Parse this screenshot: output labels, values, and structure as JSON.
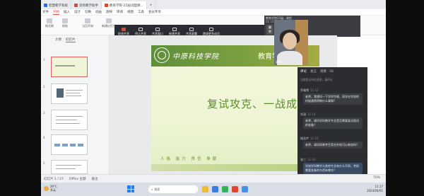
{
  "tabs": [
    {
      "label": "智慧教学系统"
    },
    {
      "label": "双师教学助手"
    },
    {
      "label": "教育学院-25届试面课..."
    },
    {
      "label": "+"
    }
  ],
  "menu": [
    "文件",
    "开始",
    "插入",
    "设计",
    "切换",
    "动画",
    "放映",
    "审阅",
    "视图",
    "工具",
    "会员专享"
  ],
  "ribbon": [
    "格式刷",
    "粘贴",
    "当页开始",
    "新建幻灯片",
    "版式",
    "重置"
  ],
  "meeting": {
    "title": "会议中",
    "items": [
      {
        "label": "结束共享"
      },
      {
        "label": "停止共享"
      },
      {
        "label": "共享窗口"
      },
      {
        "label": "新建共享"
      },
      {
        "label": "共享屏幕"
      },
      {
        "label": "邀请更多成员"
      }
    ]
  },
  "camera": {
    "name": "教育学院25届...课程",
    "time": "01:10:27",
    "btn_gray": "翻转",
    "btn_red": "录课",
    "tag": "录制"
  },
  "leftpane": {
    "tab1": "大纲",
    "tab2": "幻灯片",
    "nums": [
      "1",
      "2",
      "3",
      "4",
      "5"
    ]
  },
  "slide": {
    "school": "中原科技学院",
    "college": "教育学院25考",
    "title": "复试攻克、一战成硕",
    "motto": "人格 能力 责任 奉献"
  },
  "comments": {
    "tabs": [
      "评论",
      "发言",
      "观看 · 56"
    ],
    "note": "当前暂无评论消息，请评论",
    "items": [
      {
        "name": "乔瑜雪",
        "time": "11:12",
        "text": "老师，我想问一下学科专硕，同学在学校的时候通常得做什么事情？"
      },
      {
        "name": "肖涵",
        "time": "11:14",
        "text": "老师，请问学科教学专业是否需要复试面试的准备？"
      },
      {
        "name": "杨浩宇",
        "time": "11:15",
        "text": "老师，请问如果考生家在外地可以参加吗？"
      },
      {
        "name": "张三",
        "time": "11:16",
        "text": "学校学科教学与其他专业有什么不同，考前需要准备的东西有哪些？"
      }
    ],
    "input": "请输入评论内容"
  },
  "status": {
    "slide": "幻灯片 1 / 27",
    "theme": "Office 主题",
    "notes": "备注",
    "zoom": "70%"
  },
  "taskbar": {
    "temp": "29°C",
    "weather": "多云",
    "search": "搜索",
    "time": "11:17",
    "date": "2024/04/01"
  }
}
